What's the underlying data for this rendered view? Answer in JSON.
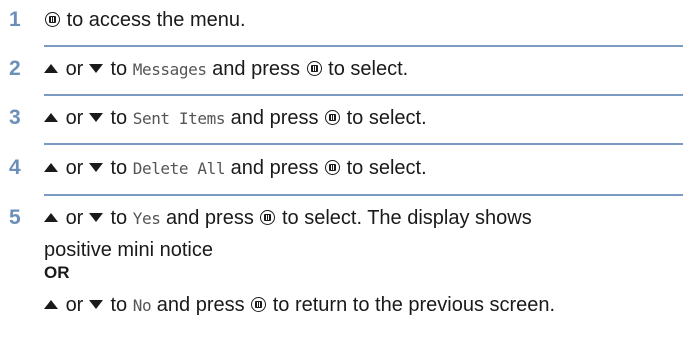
{
  "steps": [
    {
      "number": "1",
      "text_after_button": "to access the menu."
    },
    {
      "number": "2",
      "or": "or",
      "to": "to",
      "target": "Messages",
      "and_press": "and press",
      "action": "to select."
    },
    {
      "number": "3",
      "or": "or",
      "to": "to",
      "target": "Sent Items",
      "and_press": "and press",
      "action": "to select."
    },
    {
      "number": "4",
      "or": "or",
      "to": "to",
      "target": "Delete All",
      "and_press": "and press",
      "action": "to select."
    },
    {
      "number": "5",
      "or": "or",
      "to": "to",
      "target": "Yes",
      "and_press": "and press",
      "action": "to select. The display shows",
      "continuation": "positive mini notice",
      "or_label": "OR",
      "alt_target": "No",
      "alt_action": "to return to the previous screen."
    }
  ],
  "icons": {
    "select_button": "menu-select-button-icon",
    "up": "up-arrow-icon",
    "down": "down-arrow-icon"
  },
  "colors": {
    "step_number": "#6b8fb8",
    "separator": "#7b9bc2"
  }
}
